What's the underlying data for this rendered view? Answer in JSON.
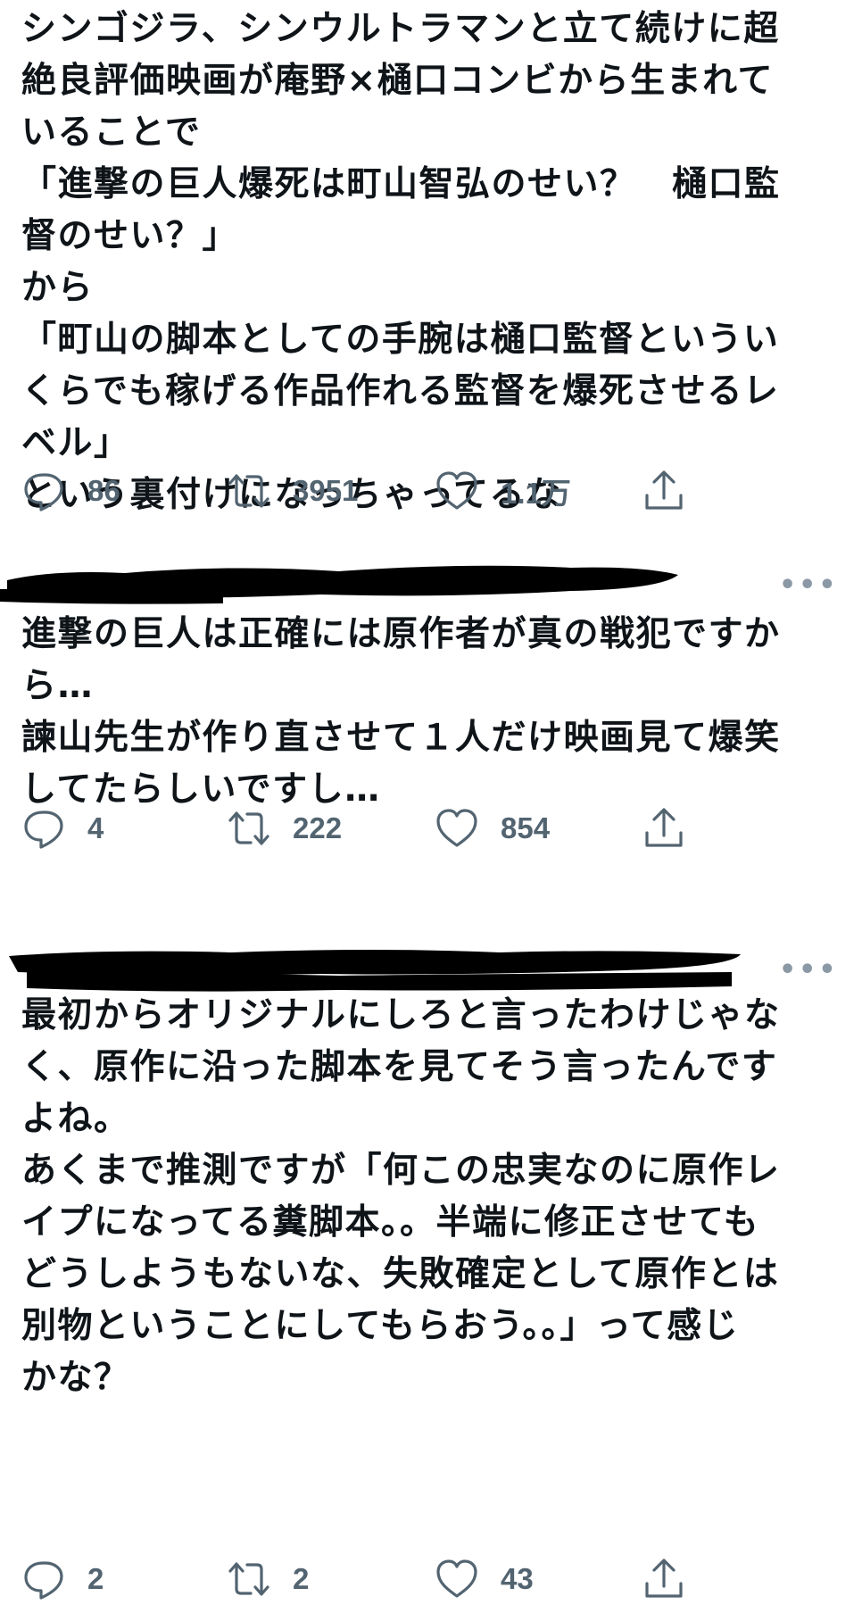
{
  "tweets": [
    {
      "text": "シンゴジラ、シンウルトラマンと立て続けに超\n絶良評価映画が庵野×樋口コンビから生まれて\nいることで\n「進撃の巨人爆死は町山智弘のせい？　樋口監\n督のせい？」\nから\n「町山の脚本としての手腕は樋口監督というい\nくらでも稼げる作品作れる監督を爆死させるレ\nベル」\nという裏付けになっちゃってるな",
      "reply_count": "86",
      "retweet_count": "3951",
      "like_count": "1.1万"
    },
    {
      "more_label": "•••",
      "text": "進撃の巨人は正確には原作者が真の戦犯ですか\nら…\n諫山先生が作り直させて１人だけ映画見て爆笑\nしてたらしいですし…",
      "reply_count": "4",
      "retweet_count": "222",
      "like_count": "854"
    },
    {
      "more_label": "•••",
      "text": "最初からオリジナルにしろと言ったわけじゃな\nく、原作に沿った脚本を見てそう言ったんです\nよね。\nあくまで推測ですが「何この忠実なのに原作レ\nイプになってる糞脚本。。半端に修正させても\nどうしようもないな、失敗確定として原作とは\n別物ということにしてもらおう。。」って感じ\nかな？",
      "reply_count": "2",
      "retweet_count": "2",
      "like_count": "43"
    }
  ],
  "colors": {
    "text": "#0f1419",
    "icon": "#536471",
    "redaction": "#000000",
    "background": "#ffffff"
  },
  "icons": {
    "reply": "reply-icon",
    "retweet": "retweet-icon",
    "like": "heart-icon",
    "share": "share-icon",
    "more": "more-icon"
  }
}
